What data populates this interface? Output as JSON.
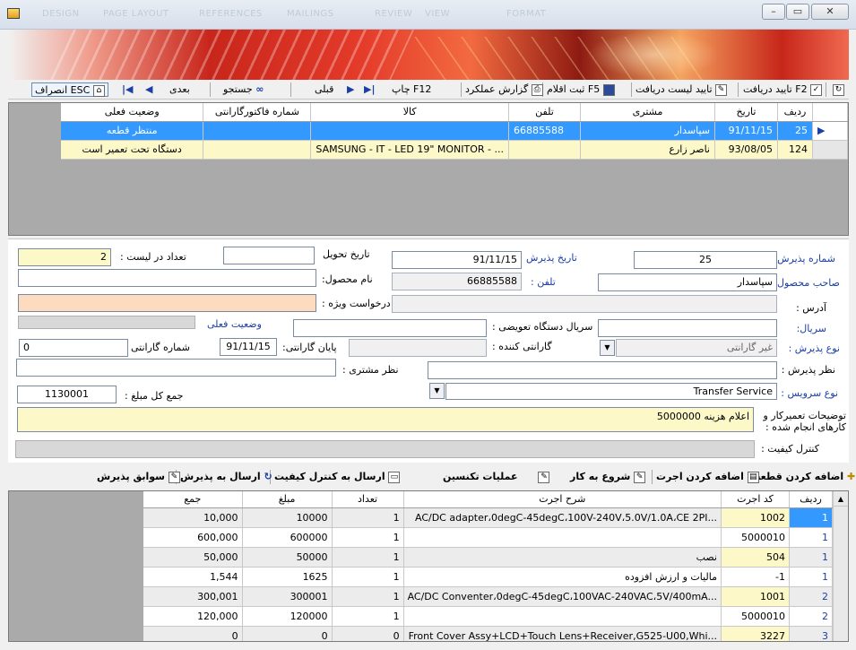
{
  "titlebar": {
    "ghost_tabs": [
      "DESIGN",
      "PAGE LAYOUT",
      "REFERENCES",
      "MAILINGS",
      "REVIEW",
      "VIEW",
      "FORMAT"
    ],
    "min": "–",
    "max": "▭",
    "close": "✕"
  },
  "toolbar": {
    "receive_confirm": "تایید دریافت F2",
    "list_confirm": "تایید لیست دریافت",
    "register": "ثبت اقلام F5",
    "report": "گزارش عملکرد",
    "print": "چاپ F12",
    "prev": "قبلی",
    "search": "جستجو",
    "next": "بعدی",
    "cancel": "انصراف ESC"
  },
  "grid1": {
    "headers": [
      "ردیف",
      "تاریخ",
      "مشتری",
      "تلفن",
      "کالا",
      "شماره فاکتورگارانتی",
      "وضعیت فعلی"
    ],
    "rows": [
      [
        "25",
        "91/11/15",
        "سپاسدار",
        "66885588",
        "",
        "",
        "منتظر قطعه"
      ],
      [
        "124",
        "93/08/05",
        "ناصر زارع",
        "",
        "SAMSUNG - IT - LED 19\" MONITOR - ...",
        "",
        "دستگاه تحت تعمیر است"
      ]
    ]
  },
  "form": {
    "reception_no_label": "شماره پذیرش",
    "reception_no": "25",
    "reception_date_label": "تاریخ پذیرش",
    "reception_date": "91/11/15",
    "delivery_date_label": "تاریخ تحویل",
    "delivery_date": "",
    "list_count_label": "تعداد در لیست :",
    "list_count": "2",
    "owner_label": "صاحب محصول :",
    "owner": "سپاسدار",
    "phone_label": "تلفن :",
    "phone": "66885588",
    "product_name_label": "نام محصول:",
    "product_name": "",
    "address_label": "آدرس :",
    "special_request_label": "درخواست ویژه :",
    "serial_label": "سریال:",
    "replacement_serial_label": "سریال دستگاه تعویضی :",
    "current_status_label": "وضعیت فعلی",
    "reception_type_label": "نوع پذیرش :",
    "reception_type": "غیر گارانتی",
    "guarantor_label": "گارانتی کننده :",
    "warranty_end_label": "پایان گارانتی:",
    "warranty_end": "91/11/15",
    "warranty_no_label": "شماره گارانتی",
    "warranty_no": "0",
    "reception_opinion_label": "نظر پذیرش :",
    "customer_opinion_label": "نظر مشتری :",
    "service_type_label": "نوع سرویس :",
    "service_type": "Transfer Service",
    "total_label": "جمع کل مبلغ :",
    "total": "1130001",
    "repair_desc_label_1": "توضیحات تعمیرکار و",
    "repair_desc_label_2": "کارهای انجام شده :",
    "repair_desc": "اعلام هزینه 5000000",
    "qc_label": "کنترل کیفیت :"
  },
  "toolbar2": {
    "add_part": "اضافه کردن قطعه",
    "add_labor": "اضافه کردن اجرت",
    "start_work": "شروع به کار",
    "tech_ops": "عملیات تکنسین",
    "send_qc": "ارسال به کنترل کیفیت",
    "send_reception": "ارسال به پذیرش",
    "history": "سوابق پذیرش"
  },
  "grid2": {
    "headers": [
      "ردیف",
      "کد اجرت",
      "شرح اجرت",
      "تعداد",
      "مبلغ",
      "جمع"
    ],
    "rows": [
      [
        "1",
        "1002",
        "AC/DC adapter،0degC-45degC،100V-240V،5.0V/1.0A،CE 2PI...",
        "1",
        "10000",
        "10,000"
      ],
      [
        "1",
        "5000010",
        "",
        "1",
        "600000",
        "600,000"
      ],
      [
        "1",
        "504",
        "نصب",
        "1",
        "50000",
        "50,000"
      ],
      [
        "1",
        "-1",
        "مالیات و ارزش افزوده",
        "1",
        "1625",
        "1,544"
      ],
      [
        "2",
        "1001",
        "AC/DC Conventer،0degC-45degC،100VAC-240VAC،5V/400mA...",
        "1",
        "300001",
        "300,001"
      ],
      [
        "2",
        "5000010",
        "",
        "1",
        "120000",
        "120,000"
      ],
      [
        "3",
        "3227",
        "Front Cover Assy+LCD+Touch Lens+Receiver,G525-U00,Whi...",
        "0",
        "0",
        "0"
      ]
    ]
  }
}
